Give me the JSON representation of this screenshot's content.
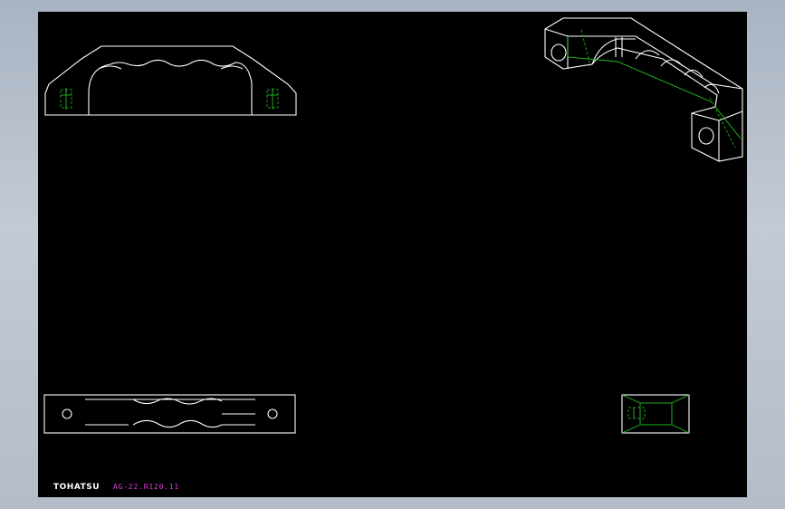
{
  "title_block": {
    "brand": "TOHATSU",
    "part_number": "AG-22.R120.11"
  },
  "colors": {
    "background": "#000000",
    "outline": "#ffffff",
    "hidden_lines": "#22c222",
    "part_number_text": "#e040e0",
    "frame": "#b4bcc9"
  },
  "views": [
    "front-view",
    "isometric-view",
    "top-view",
    "side-view"
  ]
}
